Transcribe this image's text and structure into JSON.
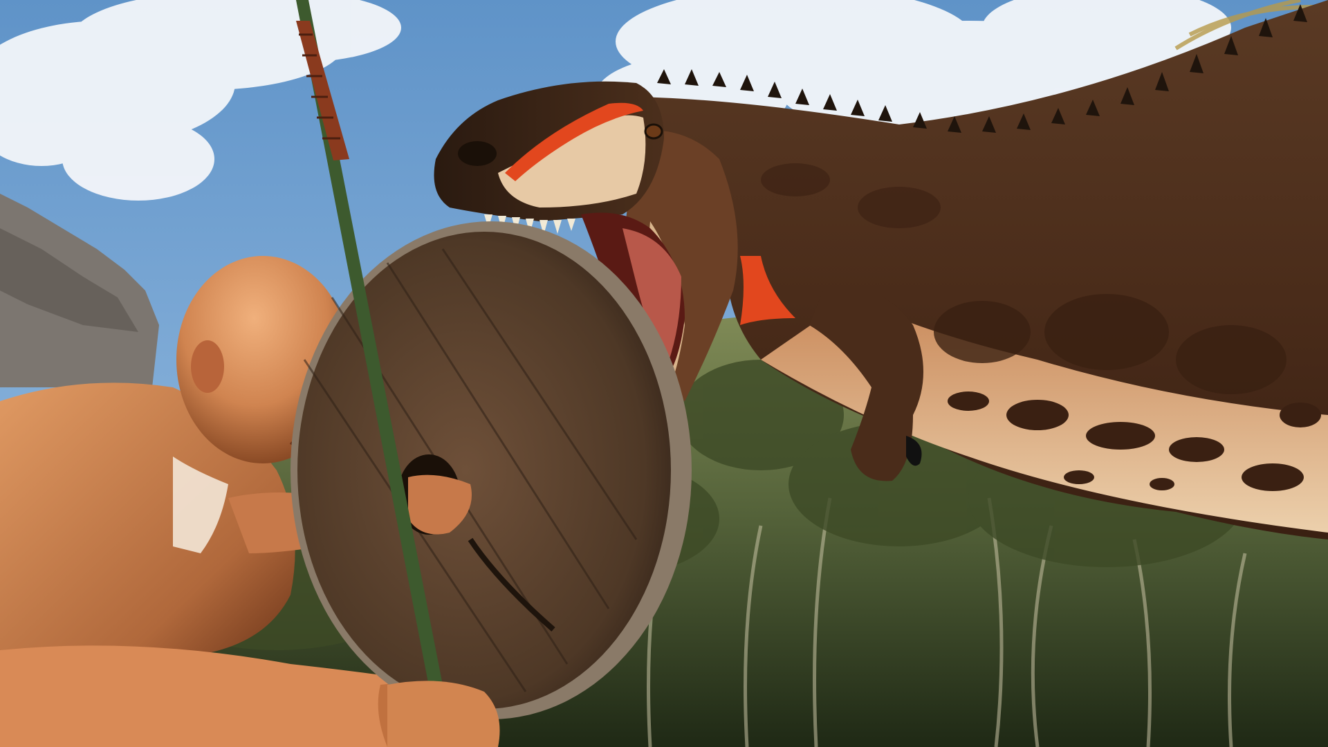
{
  "scene": {
    "colors": {
      "sky_top": "#5f93c8",
      "sky_bottom": "#9ec2e4",
      "cloud": "#f3f6fa",
      "rock": "#7c7670",
      "jungle_dark": "#2f3a1e",
      "jungle_light": "#6d7a45",
      "skin": "#d98a56",
      "skin_shadow": "#8a4a25",
      "shield_wood": "#5e4431",
      "shield_rim": "#8a7a68",
      "spear_shaft": "#3d5a2e",
      "spear_wrap": "#8a3a1e",
      "dino_body": "#5a3a24",
      "dino_belly": "#e7c9a5",
      "dino_red": "#e2471e",
      "dino_spot": "#3a2012"
    }
  }
}
